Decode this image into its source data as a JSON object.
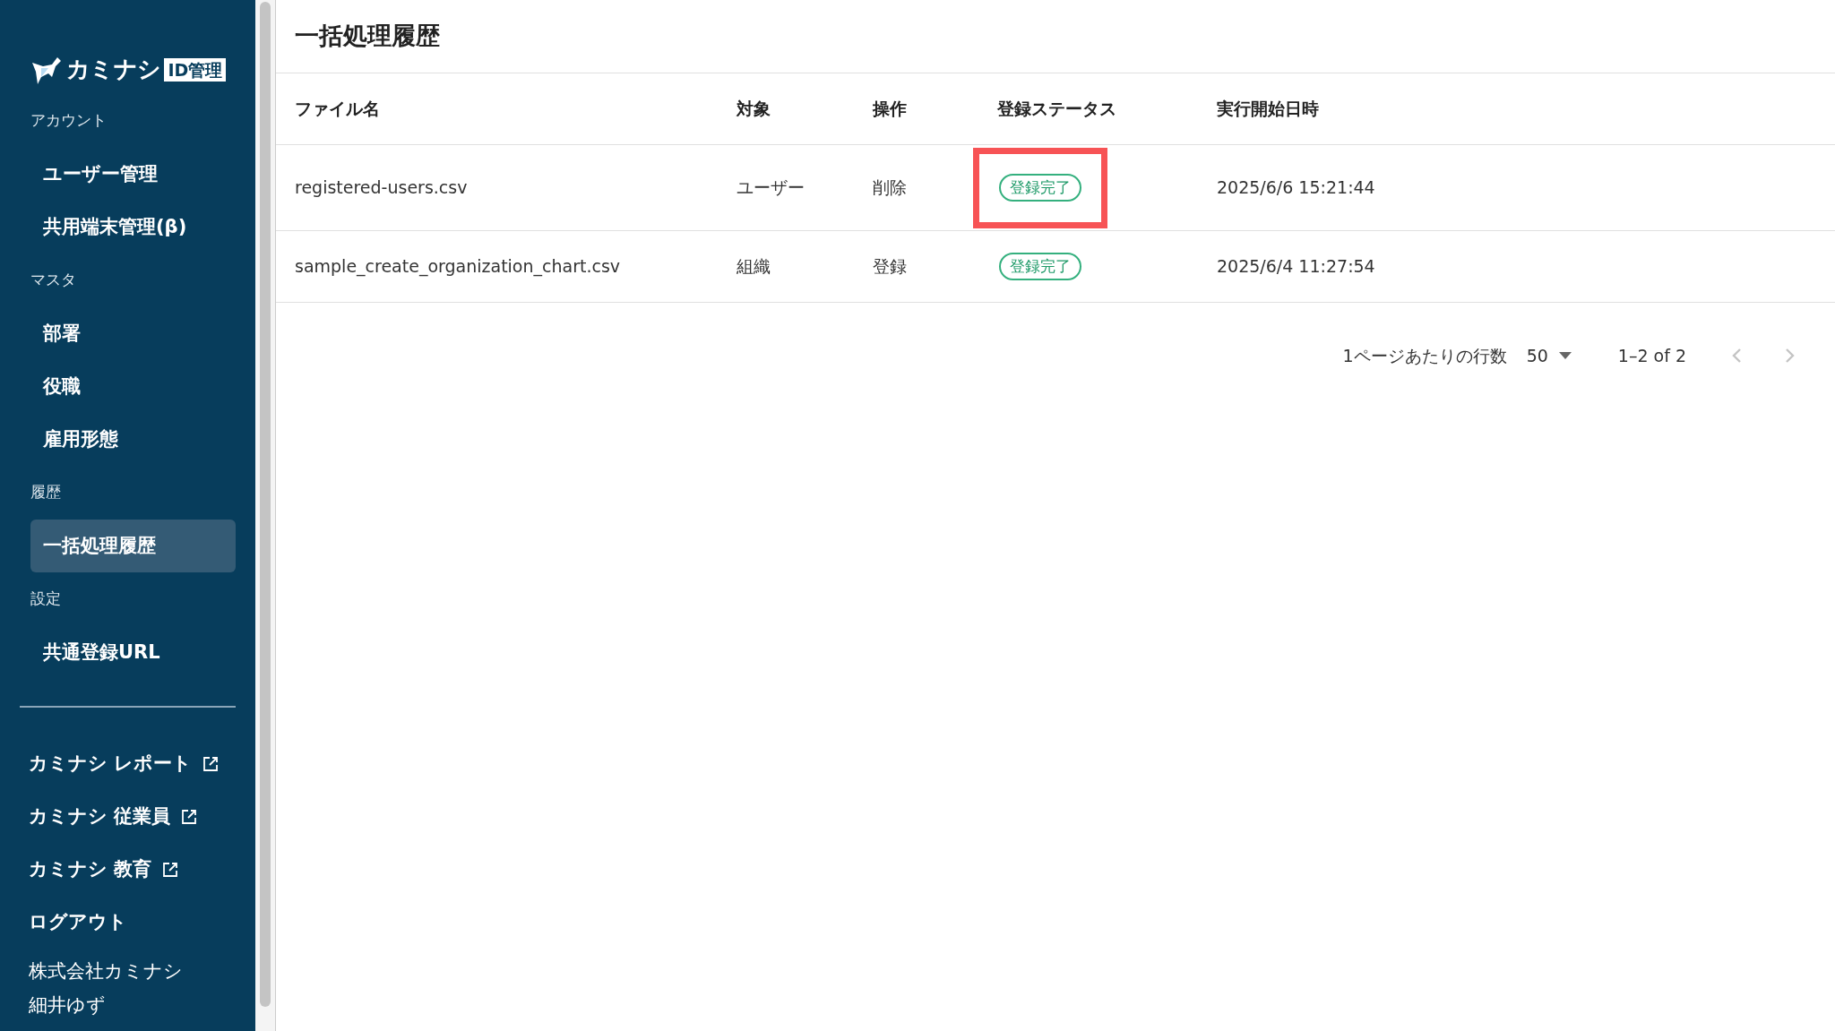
{
  "sidebar": {
    "logo": {
      "text": "カミナシ",
      "badge": "ID管理"
    },
    "sections": [
      {
        "heading": "アカウント",
        "items": [
          {
            "label": "ユーザー管理",
            "selected": false
          },
          {
            "label": "共用端末管理(β)",
            "selected": false
          }
        ]
      },
      {
        "heading": "マスタ",
        "items": [
          {
            "label": "部署",
            "selected": false
          },
          {
            "label": "役職",
            "selected": false
          },
          {
            "label": "雇用形態",
            "selected": false
          }
        ]
      },
      {
        "heading": "履歴",
        "items": [
          {
            "label": "一括処理履歴",
            "selected": true
          }
        ]
      },
      {
        "heading": "設定",
        "items": [
          {
            "label": "共通登録URL",
            "selected": false
          }
        ]
      }
    ],
    "links": [
      {
        "label": "カミナシ レポート",
        "external": true
      },
      {
        "label": "カミナシ 従業員",
        "external": true
      },
      {
        "label": "カミナシ 教育",
        "external": true
      },
      {
        "label": "ログアウト",
        "external": false
      }
    ],
    "company": "株式会社カミナシ",
    "user": "細井ゆず"
  },
  "page_title": "一括処理履歴",
  "table": {
    "columns": [
      "ファイル名",
      "対象",
      "操作",
      "登録ステータス",
      "実行開始日時"
    ],
    "rows": [
      {
        "file": "registered-users.csv",
        "target": "ユーザー",
        "operation": "削除",
        "status": "登録完了",
        "highlighted": true,
        "started": "2025/6/6 15:21:44"
      },
      {
        "file": "sample_create_organization_chart.csv",
        "target": "組織",
        "operation": "登録",
        "status": "登録完了",
        "highlighted": false,
        "started": "2025/6/4 11:27:54"
      }
    ]
  },
  "pagination": {
    "rows_label": "1ページあたりの行数",
    "rows_per_page": "50",
    "range": "1–2 of 2"
  }
}
